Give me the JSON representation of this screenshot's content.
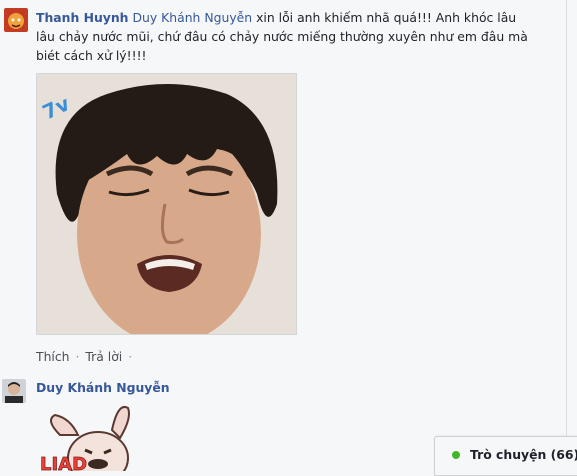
{
  "comment1": {
    "author": "Thanh Huynh",
    "mention": "Duy Khánh Nguyễn",
    "text": " xin lỗi anh khiếm nhã quá!!! Anh khóc lâu lâu chảy nước mũi, chứ đâu có chảy nước miếng thường xuyên như em đâu mà biét cách xử lý!!!!",
    "photo_caption": "",
    "actions": {
      "like": "Thích",
      "reply": "Trả lời",
      "separator": "·"
    }
  },
  "comment2": {
    "author": "Duy Khánh Nguyễn",
    "sticker_text": "LIAD"
  },
  "chat": {
    "label": "Trò chuyện (66)",
    "status_color": "#42b72a"
  },
  "colors": {
    "link": "#365899",
    "background": "#f6f7f9",
    "muted": "#4b4f56"
  }
}
